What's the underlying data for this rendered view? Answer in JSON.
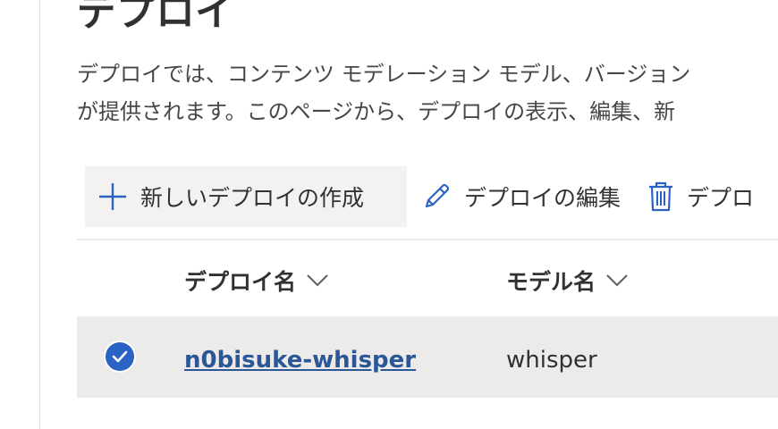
{
  "page": {
    "title": "デプロイ",
    "description_line1": "デプロイでは、コンテンツ モデレーション モデル、バージョン",
    "description_line2": "が提供されます。このページから、デプロイの表示、編集、新"
  },
  "toolbar": {
    "create_label": "新しいデプロイの作成",
    "edit_label": "デプロイの編集",
    "delete_label": "デプロ"
  },
  "table": {
    "columns": [
      {
        "label": "デプロイ名"
      },
      {
        "label": "モデル名"
      }
    ],
    "rows": [
      {
        "name": "n0bisuke-whisper",
        "model": "whisper",
        "selected": true
      }
    ]
  },
  "colors": {
    "accent": "#2b63c4",
    "link": "#2b5797",
    "row_selected_bg": "#edebe9",
    "button_bg": "#f3f2f1"
  },
  "icons": {
    "create": "plus-icon",
    "edit": "pencil-icon",
    "delete": "trash-icon",
    "sort": "chevron-down-icon",
    "selected": "check-circle-icon"
  }
}
